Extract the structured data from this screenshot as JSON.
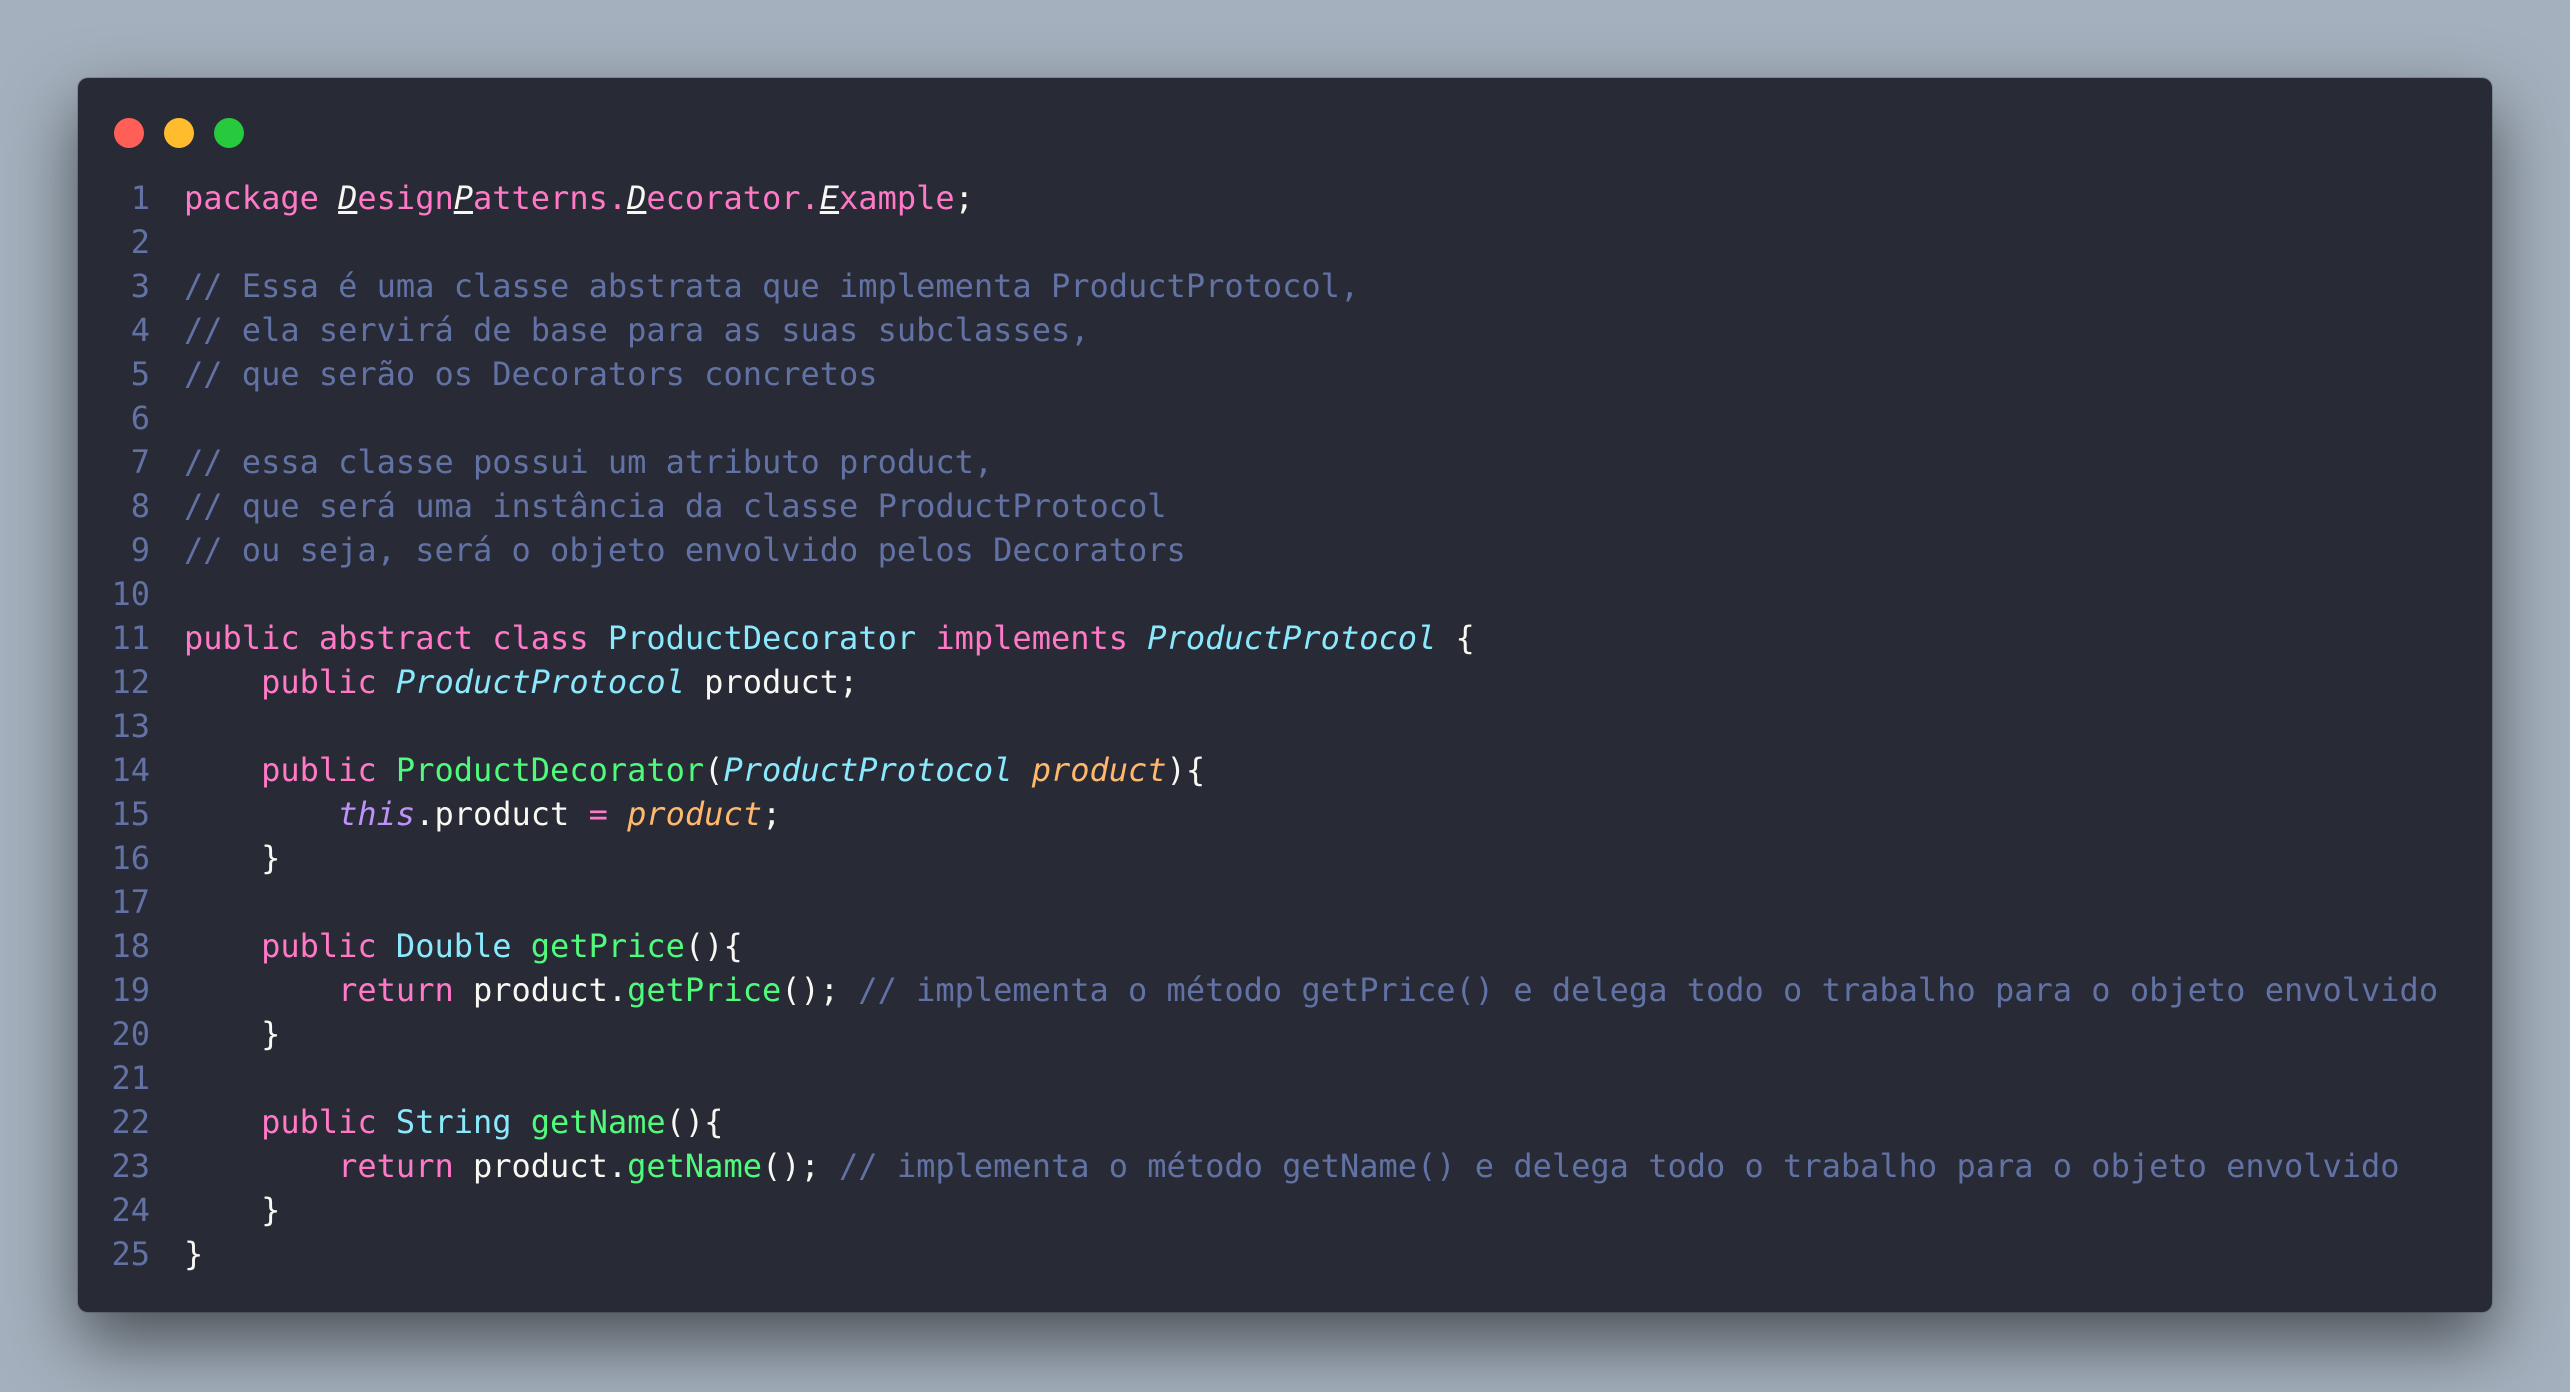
{
  "window": {
    "controls": {
      "close_color": "#ff5f56",
      "minimize_color": "#ffbd2e",
      "maximize_color": "#27c93f"
    }
  },
  "theme": {
    "background": "#282a36",
    "line_number": "#6272a4",
    "keyword": "#ff79c6",
    "type": "#8be9fd",
    "function": "#50fa7b",
    "parameter": "#ffb86c",
    "this": "#bd93f9",
    "comment": "#6272a4",
    "plain": "#f8f8f2"
  },
  "code": {
    "lines": [
      {
        "number": "1",
        "tokens": [
          {
            "text": "package ",
            "kind": "keyword"
          },
          {
            "text": "D",
            "kind": "pkg-cap"
          },
          {
            "text": "esign",
            "kind": "pkg"
          },
          {
            "text": "P",
            "kind": "pkg-cap"
          },
          {
            "text": "atterns.",
            "kind": "pkg"
          },
          {
            "text": "D",
            "kind": "pkg-cap"
          },
          {
            "text": "ecorator.",
            "kind": "pkg"
          },
          {
            "text": "E",
            "kind": "pkg-cap"
          },
          {
            "text": "xample",
            "kind": "pkg"
          },
          {
            "text": ";",
            "kind": "plain"
          }
        ]
      },
      {
        "number": "2",
        "tokens": []
      },
      {
        "number": "3",
        "tokens": [
          {
            "text": "// Essa é uma classe abstrata que implementa ProductProtocol,",
            "kind": "comment"
          }
        ]
      },
      {
        "number": "4",
        "tokens": [
          {
            "text": "// ela servirá de base para as suas subclasses,",
            "kind": "comment"
          }
        ]
      },
      {
        "number": "5",
        "tokens": [
          {
            "text": "// que serão os Decorators concretos",
            "kind": "comment"
          }
        ]
      },
      {
        "number": "6",
        "tokens": []
      },
      {
        "number": "7",
        "tokens": [
          {
            "text": "// essa classe possui um atributo product,",
            "kind": "comment"
          }
        ]
      },
      {
        "number": "8",
        "tokens": [
          {
            "text": "// que será uma instância da classe ProductProtocol",
            "kind": "comment"
          }
        ]
      },
      {
        "number": "9",
        "tokens": [
          {
            "text": "// ou seja, será o objeto envolvido pelos Decorators",
            "kind": "comment"
          }
        ]
      },
      {
        "number": "10",
        "tokens": []
      },
      {
        "number": "11",
        "tokens": [
          {
            "text": "public abstract class ",
            "kind": "keyword"
          },
          {
            "text": "ProductDecorator",
            "kind": "type"
          },
          {
            "text": " implements ",
            "kind": "keyword"
          },
          {
            "text": "ProductProtocol",
            "kind": "type-italic"
          },
          {
            "text": " {",
            "kind": "plain"
          }
        ]
      },
      {
        "number": "12",
        "tokens": [
          {
            "text": "    ",
            "kind": "plain"
          },
          {
            "text": "public ",
            "kind": "keyword"
          },
          {
            "text": "ProductProtocol",
            "kind": "type-italic"
          },
          {
            "text": " product;",
            "kind": "plain"
          }
        ]
      },
      {
        "number": "13",
        "tokens": []
      },
      {
        "number": "14",
        "tokens": [
          {
            "text": "    ",
            "kind": "plain"
          },
          {
            "text": "public ",
            "kind": "keyword"
          },
          {
            "text": "ProductDecorator",
            "kind": "func"
          },
          {
            "text": "(",
            "kind": "plain"
          },
          {
            "text": "ProductProtocol",
            "kind": "type-italic"
          },
          {
            "text": " ",
            "kind": "plain"
          },
          {
            "text": "product",
            "kind": "param"
          },
          {
            "text": "){",
            "kind": "plain"
          }
        ]
      },
      {
        "number": "15",
        "tokens": [
          {
            "text": "        ",
            "kind": "plain"
          },
          {
            "text": "this",
            "kind": "this"
          },
          {
            "text": ".product ",
            "kind": "plain"
          },
          {
            "text": "=",
            "kind": "keyword"
          },
          {
            "text": " ",
            "kind": "plain"
          },
          {
            "text": "product",
            "kind": "param"
          },
          {
            "text": ";",
            "kind": "plain"
          }
        ]
      },
      {
        "number": "16",
        "tokens": [
          {
            "text": "    }",
            "kind": "plain"
          }
        ]
      },
      {
        "number": "17",
        "tokens": []
      },
      {
        "number": "18",
        "tokens": [
          {
            "text": "    ",
            "kind": "plain"
          },
          {
            "text": "public ",
            "kind": "keyword"
          },
          {
            "text": "Double",
            "kind": "type"
          },
          {
            "text": " ",
            "kind": "plain"
          },
          {
            "text": "getPrice",
            "kind": "func"
          },
          {
            "text": "(){",
            "kind": "plain"
          }
        ]
      },
      {
        "number": "19",
        "tokens": [
          {
            "text": "        ",
            "kind": "plain"
          },
          {
            "text": "return ",
            "kind": "keyword"
          },
          {
            "text": "product.",
            "kind": "plain"
          },
          {
            "text": "getPrice",
            "kind": "func"
          },
          {
            "text": "(); ",
            "kind": "plain"
          },
          {
            "text": "// implementa o método getPrice() e delega todo o trabalho para o objeto envolvido",
            "kind": "comment"
          }
        ]
      },
      {
        "number": "20",
        "tokens": [
          {
            "text": "    }",
            "kind": "plain"
          }
        ]
      },
      {
        "number": "21",
        "tokens": []
      },
      {
        "number": "22",
        "tokens": [
          {
            "text": "    ",
            "kind": "plain"
          },
          {
            "text": "public ",
            "kind": "keyword"
          },
          {
            "text": "String",
            "kind": "type"
          },
          {
            "text": " ",
            "kind": "plain"
          },
          {
            "text": "getName",
            "kind": "func"
          },
          {
            "text": "(){",
            "kind": "plain"
          }
        ]
      },
      {
        "number": "23",
        "tokens": [
          {
            "text": "        ",
            "kind": "plain"
          },
          {
            "text": "return ",
            "kind": "keyword"
          },
          {
            "text": "product.",
            "kind": "plain"
          },
          {
            "text": "getName",
            "kind": "func"
          },
          {
            "text": "(); ",
            "kind": "plain"
          },
          {
            "text": "// implementa o método getName() e delega todo o trabalho para o objeto envolvido",
            "kind": "comment"
          }
        ]
      },
      {
        "number": "24",
        "tokens": [
          {
            "text": "    }",
            "kind": "plain"
          }
        ]
      },
      {
        "number": "25",
        "tokens": [
          {
            "text": "}",
            "kind": "plain"
          }
        ]
      }
    ]
  }
}
